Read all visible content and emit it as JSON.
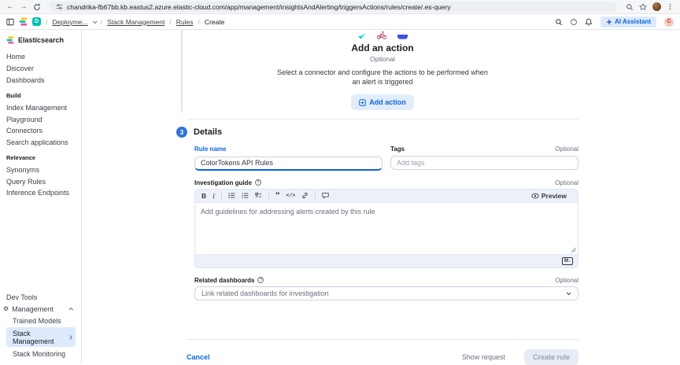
{
  "browser": {
    "url": "chandrika-fb67bb.kb.eastus2.azure.elastic-cloud.com/app/management/insightsAndAlerting/triggersActions/rules/create/.es-query"
  },
  "icons": {
    "back": "←",
    "forward": "→",
    "separator": "/",
    "question": "?",
    "gear": "⚙",
    "bold": "B",
    "italic": "I",
    "quote": "“",
    "code": "</>",
    "markdown_logo": "M↓"
  },
  "top_nav": {
    "deployment_badge": "D",
    "deployment_label": "Deployme...",
    "breadcrumbs": [
      "Stack Management",
      "Rules",
      "Create"
    ],
    "ai_assistant_label": "AI Assistant",
    "user_initial": "C"
  },
  "sidebar": {
    "app_title": "Elasticsearch",
    "primary_items": [
      "Home",
      "Discover",
      "Dashboards"
    ],
    "sections": [
      {
        "label": "Build",
        "items": [
          "Index Management",
          "Playground",
          "Connectors",
          "Search applications"
        ]
      },
      {
        "label": "Relevance",
        "items": [
          "Synonyms",
          "Query Rules",
          "Inference Endpoints"
        ]
      }
    ],
    "footer": {
      "dev_tools": "Dev Tools",
      "management": "Management",
      "trained_models": "Trained Models",
      "stack_management": "Stack Management",
      "stack_monitoring": "Stack Monitoring"
    }
  },
  "add_action": {
    "title": "Add an action",
    "optional": "Optional",
    "description": "Select a connector and configure the actions to be performed when an alert is triggered",
    "button_label": "Add action"
  },
  "details": {
    "step_number": "3",
    "title": "Details",
    "rule_name": {
      "label": "Rule name",
      "value": "ColorTokens API Rules"
    },
    "tags": {
      "label": "Tags",
      "optional": "Optional",
      "placeholder": "Add tags"
    },
    "investigation_guide": {
      "label": "Investigation guide",
      "optional": "Optional",
      "preview_label": "Preview",
      "placeholder": "Add guidelines for addressing alerts created by this rule"
    },
    "related_dashboards": {
      "label": "Related dashboards",
      "optional": "Optional",
      "placeholder": "Link related dashboards for investigation"
    }
  },
  "footer": {
    "cancel_label": "Cancel",
    "show_request_label": "Show request",
    "create_rule_label": "Create rule"
  }
}
